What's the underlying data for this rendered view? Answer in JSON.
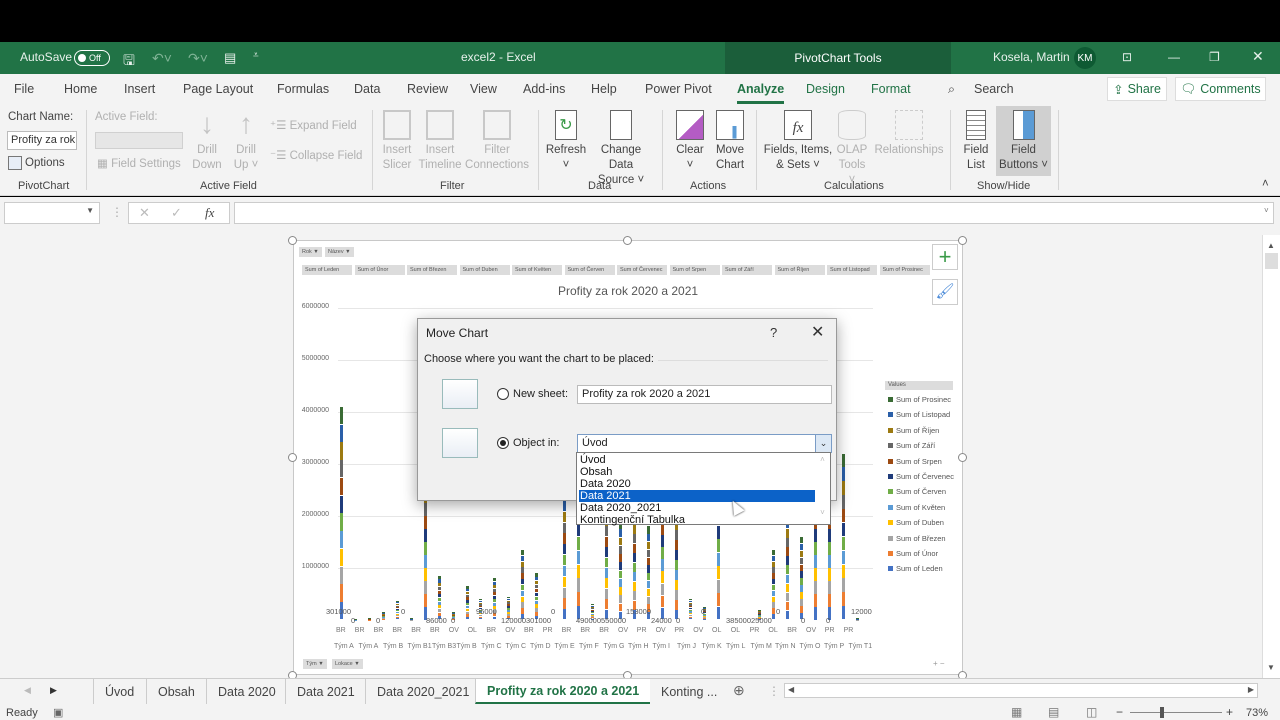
{
  "window": {
    "autosave_label": "AutoSave",
    "autosave_state": "Off",
    "doc_title": "excel2  -  Excel",
    "context_title": "PivotChart Tools",
    "user_name": "Kosela, Martin",
    "user_initials": "KM"
  },
  "menu": {
    "items": [
      "File",
      "Home",
      "Insert",
      "Page Layout",
      "Formulas",
      "Data",
      "Review",
      "View",
      "Add-ins",
      "Help",
      "Power Pivot",
      "Analyze",
      "Design",
      "Format"
    ],
    "active": "Analyze",
    "search": "Search",
    "share": "Share",
    "comments": "Comments"
  },
  "ribbon": {
    "pivotchart": {
      "chart_name_label": "Chart Name:",
      "chart_name_value": "Profity za rok",
      "options": "Options",
      "group": "PivotChart"
    },
    "active_field": {
      "label": "Active Field:",
      "field_settings": "Field Settings",
      "drill_down": [
        "Drill",
        "Down"
      ],
      "drill_up": [
        "Drill",
        "Up"
      ],
      "expand": "Expand Field",
      "collapse": "Collapse Field",
      "group": "Active Field"
    },
    "filter": {
      "insert_slicer": [
        "Insert",
        "Slicer"
      ],
      "insert_timeline": [
        "Insert",
        "Timeline"
      ],
      "filter_connections": [
        "Filter",
        "Connections"
      ],
      "group": "Filter"
    },
    "data": {
      "refresh": [
        "Refresh",
        "˅"
      ],
      "change_source": [
        "Change Data",
        "Source ˅"
      ],
      "group": "Data"
    },
    "actions": {
      "clear": [
        "Clear",
        "˅"
      ],
      "move_chart": [
        "Move",
        "Chart"
      ],
      "group": "Actions"
    },
    "calculations": {
      "fields_items": [
        "Fields, Items,",
        "& Sets ˅"
      ],
      "olap": [
        "OLAP",
        "Tools ˅"
      ],
      "relationships": "Relationships",
      "group": "Calculations"
    },
    "showhide": {
      "field_list": [
        "Field",
        "List"
      ],
      "field_buttons": [
        "Field",
        "Buttons ˅"
      ],
      "group": "Show/Hide"
    }
  },
  "formula_bar": {
    "name_box": "",
    "formula": "",
    "fx": "fx"
  },
  "chart": {
    "title": "Profity za rok 2020 a 2021",
    "filter_buttons": [
      "Rok ▼",
      "Název ▼"
    ],
    "axis_buttons": [
      "Tým ▼",
      "Lokace ▼"
    ],
    "value_buttons": [
      "Sum of Leden",
      "Sum of Únor",
      "Sum of Březen",
      "Sum of Duben",
      "Sum of Květen",
      "Sum of Červen",
      "Sum of Červenec",
      "Sum of Srpen",
      "Sum of Září",
      "Sum of Říjen",
      "Sum of Listopad",
      "Sum of Prosinec"
    ],
    "legend_title": "Values",
    "legend": [
      {
        "name": "Sum of Prosinec",
        "color": "#3a6b35"
      },
      {
        "name": "Sum of Listopad",
        "color": "#2a5fa8"
      },
      {
        "name": "Sum of Říjen",
        "color": "#9c7a12"
      },
      {
        "name": "Sum of Září",
        "color": "#666666"
      },
      {
        "name": "Sum of Srpen",
        "color": "#9c4a12"
      },
      {
        "name": "Sum of Červenec",
        "color": "#1f3b7a"
      },
      {
        "name": "Sum of Červen",
        "color": "#70ad47"
      },
      {
        "name": "Sum of Květen",
        "color": "#5b9bd5"
      },
      {
        "name": "Sum of Duben",
        "color": "#ffc000"
      },
      {
        "name": "Sum of Březen",
        "color": "#a5a5a5"
      },
      {
        "name": "Sum of Únor",
        "color": "#ed7d31"
      },
      {
        "name": "Sum of Leden",
        "color": "#4472c4"
      }
    ],
    "y_ticks": [
      "6000000",
      "5000000",
      "4000000",
      "3000000",
      "2000000",
      "1000000",
      "0"
    ],
    "x_locations": [
      "BR",
      "BR",
      "BR",
      "BR",
      "BR",
      "BR",
      "OV",
      "OL",
      "BR",
      "OV",
      "BR",
      "PR",
      "BR",
      "BR",
      "BR",
      "OV",
      "PR",
      "OV",
      "PR",
      "OV",
      "OL",
      "OL",
      "PR",
      "OL",
      "BR",
      "OV",
      "PR",
      "PR"
    ],
    "x_teams": [
      "Tým A",
      "Tým A",
      "Tým B",
      "Tým B1",
      "Tým B3",
      "Tým B",
      "Tým C",
      "Tým C",
      "Tým D",
      "Tým E",
      "Tým F",
      "Tým G",
      "Tým H",
      "Tým I",
      "Tým J",
      "Tým K",
      "Tým L",
      "Tým M",
      "Tým N",
      "Tým O",
      "Tým P",
      "Tým T1"
    ],
    "data_labels": [
      "301000",
      "0",
      "0",
      "0",
      "86000",
      "0",
      "96000",
      "120000",
      "301000",
      "0",
      "490000",
      "550000",
      "153000",
      "24000",
      "0",
      "0",
      "385000",
      "25000",
      "0",
      "0",
      "0",
      "12000"
    ]
  },
  "dialog": {
    "title": "Move Chart",
    "help": "?",
    "close": "✕",
    "instruction": "Choose where you want the chart to be placed:",
    "new_sheet_label": "New sheet:",
    "new_sheet_value": "Profity za rok 2020 a 2021",
    "object_in_label": "Object in:",
    "object_in_value": "Úvod",
    "new_sheet_selected": false,
    "object_in_selected": true,
    "dropdown_options": [
      "Úvod",
      "Obsah",
      "Data 2020",
      "Data 2021",
      "Data 2020_2021",
      "Kontingenční Tabulka"
    ],
    "highlighted_option": "Data 2021"
  },
  "sheet_tabs": {
    "tabs": [
      "Úvod",
      "Obsah",
      "Data 2020",
      "Data 2021",
      "Data 2020_2021",
      "Profity za rok 2020 a 2021",
      "Konting ..."
    ],
    "active": "Profity za rok 2020 a 2021"
  },
  "status": {
    "ready": "Ready",
    "zoom": "73%",
    "zoom_level": 0.73
  }
}
